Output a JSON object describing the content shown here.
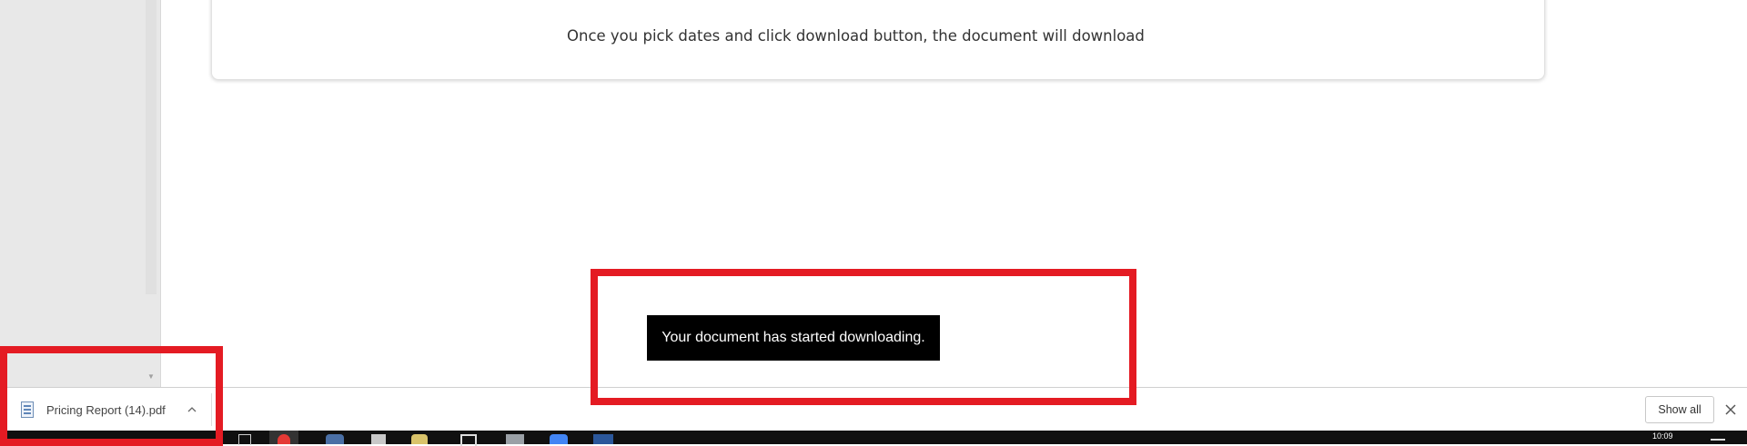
{
  "card": {
    "hint_text": "Once you pick dates and click download button, the document will download"
  },
  "toast": {
    "message": "Your document has started downloading."
  },
  "download_bar": {
    "file_name": "Pricing Report (14).pdf",
    "file_icon": "pdf-file-icon",
    "chevron_icon": "chevron-up-icon",
    "show_all_label": "Show all",
    "close_icon": "close-icon"
  },
  "taskbar": {
    "time": "10:09"
  },
  "colors": {
    "highlight": "#e41b23",
    "accent_green": "#4caf50",
    "toast_bg": "#000000"
  }
}
